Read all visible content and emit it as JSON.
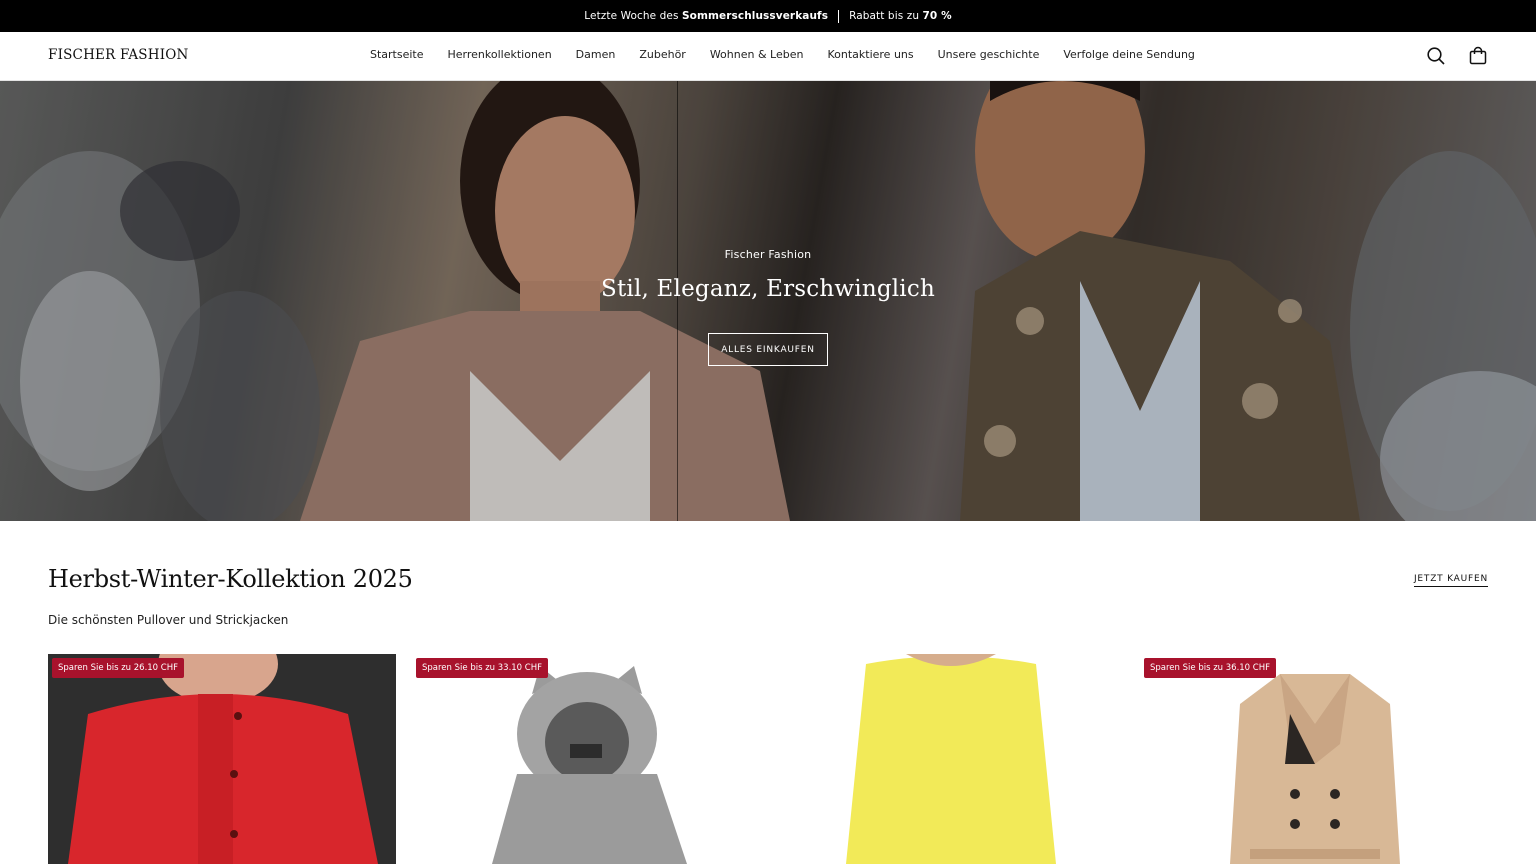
{
  "announcement": {
    "text_a": "Letzte Woche des ",
    "text_a_bold": "Sommerschlussverkaufs",
    "text_b": "Rabatt bis zu ",
    "text_b_bold": "70 %"
  },
  "header": {
    "logo": "FISCHER FASHION",
    "nav": [
      "Startseite",
      "Herrenkollektionen",
      "Damen",
      "Zubehör",
      "Wohnen & Leben",
      "Kontaktiere uns",
      "Unsere geschichte",
      "Verfolge deine Sendung"
    ],
    "icons": [
      "search-icon",
      "shopping-bag-icon"
    ]
  },
  "hero": {
    "eyebrow": "Fischer Fashion",
    "title": "Stil, Eleganz, Erschwinglich",
    "button": "ALLES EINKAUFEN"
  },
  "collection": {
    "title": "Herbst-Winter-Kollektion 2025",
    "subtitle": "Die schönsten Pullover und Strickjacken",
    "link": "JETZT KAUFEN",
    "products": [
      {
        "badge": "Sparen Sie bis zu 26.10 CHF",
        "color": "#d8262c"
      },
      {
        "badge": "Sparen Sie bis zu 33.10 CHF",
        "color": "#9a9a9a"
      },
      {
        "badge": "",
        "color": "#f2ea58"
      },
      {
        "badge": "Sparen Sie bis zu 36.10 CHF",
        "color": "#d8b896"
      }
    ]
  },
  "colors": {
    "announcement_bg": "#000000",
    "badge_bg": "#a8122c",
    "text": "#1a1a1a"
  }
}
